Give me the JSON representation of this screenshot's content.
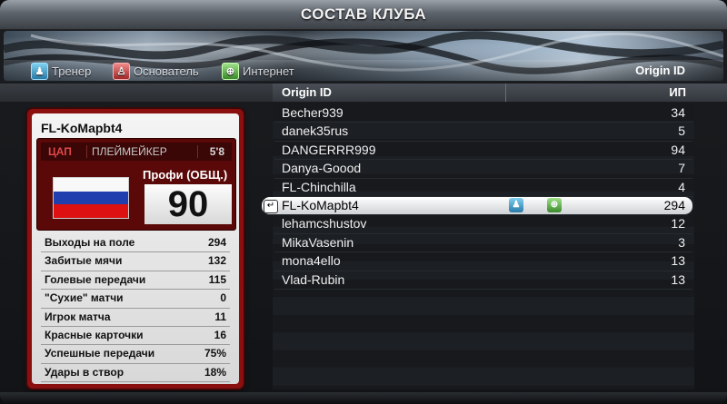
{
  "window": {
    "title": "СОСТАВ КЛУБА"
  },
  "legend": {
    "items": [
      {
        "label": "Тренер",
        "icon": "coach-icon"
      },
      {
        "label": "Основатель",
        "icon": "founder-icon"
      },
      {
        "label": "Интернет",
        "icon": "internet-icon"
      }
    ],
    "right_label": "Origin ID"
  },
  "columns": {
    "origin_id": "Origin ID",
    "ip": "ИП"
  },
  "player_card": {
    "name": "FL-KoMapbt4",
    "position": "ЦАП",
    "role": "ПЛЕЙМЕЙКЕР",
    "height": "5'8",
    "rating_label": "Профи (ОБЩ.)",
    "rating": "90",
    "flag": "russia-flag",
    "stats": [
      {
        "label": "Выходы на поле",
        "value": "294"
      },
      {
        "label": "Забитые мячи",
        "value": "132"
      },
      {
        "label": "Голевые передачи",
        "value": "115"
      },
      {
        "label": "\"Сухие\" матчи",
        "value": "0"
      },
      {
        "label": "Игрок матча",
        "value": "11"
      },
      {
        "label": "Красные карточки",
        "value": "16"
      },
      {
        "label": "Успешные передачи",
        "value": "75%"
      },
      {
        "label": "Удары в створ",
        "value": "18%"
      }
    ]
  },
  "members": [
    {
      "name": "Becher939",
      "value": "34"
    },
    {
      "name": "danek35rus",
      "value": "5"
    },
    {
      "name": "DANGERRR999",
      "value": "94"
    },
    {
      "name": "Danya-Goood",
      "value": "7"
    },
    {
      "name": "FL-Chinchilla",
      "value": "4"
    },
    {
      "name": "FL-KoMapbt4",
      "value": "294",
      "selected": true
    },
    {
      "name": "lehamcshustov",
      "value": "12"
    },
    {
      "name": "MikaVasenin",
      "value": "3"
    },
    {
      "name": "mona4ello",
      "value": "13"
    },
    {
      "name": "Vlad-Rubin",
      "value": "13"
    }
  ],
  "colors": {
    "card_red": "#8a1010",
    "position_red": "#e04848"
  }
}
